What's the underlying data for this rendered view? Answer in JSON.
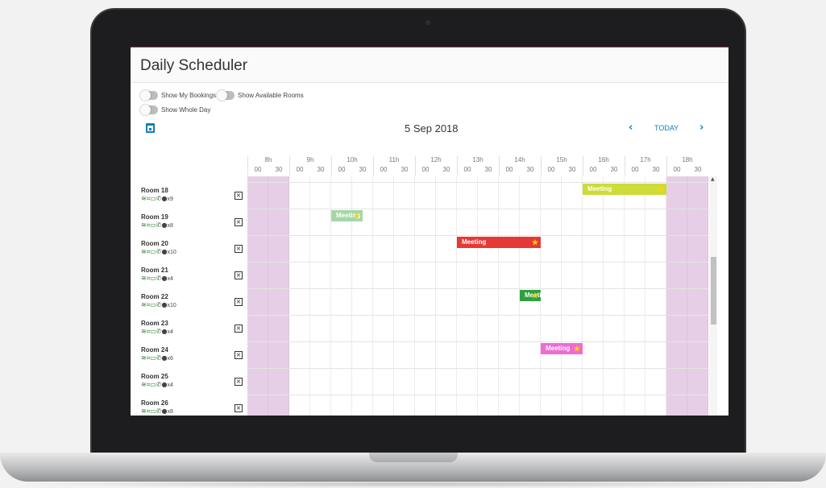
{
  "app": {
    "title": "Daily Scheduler"
  },
  "toggles": {
    "my_bookings": "Show My Bookings",
    "available_rooms": "Show Available Rooms",
    "whole_day": "Show Whole Day"
  },
  "date_nav": {
    "date": "5 Sep 2018",
    "prev": "‹",
    "today": "TODAY",
    "next": "›"
  },
  "timeline": {
    "hours": [
      "8h",
      "9h",
      "10h",
      "11h",
      "12h",
      "13h",
      "14h",
      "15h",
      "16h",
      "17h",
      "18h"
    ],
    "minutes": [
      "00",
      "30"
    ]
  },
  "rooms": [
    {
      "name": "Room 18",
      "capacity": "x9"
    },
    {
      "name": "Room 19",
      "capacity": "x8"
    },
    {
      "name": "Room 20",
      "capacity": "x10"
    },
    {
      "name": "Room 21",
      "capacity": "x4"
    },
    {
      "name": "Room 22",
      "capacity": "x10"
    },
    {
      "name": "Room 23",
      "capacity": "x4"
    },
    {
      "name": "Room 24",
      "capacity": "x6"
    },
    {
      "name": "Room 25",
      "capacity": "x4"
    },
    {
      "name": "Room 26",
      "capacity": "x8"
    }
  ],
  "events": [
    {
      "room_index": 0,
      "label": "Meeting",
      "start": "16:00",
      "end": "18:00",
      "color": "#cddc39"
    },
    {
      "room_index": 1,
      "label": "Meeting",
      "start": "10:00",
      "end": "10:45",
      "color": "#a5d6a7"
    },
    {
      "room_index": 2,
      "label": "Meeting",
      "start": "13:00",
      "end": "15:00",
      "color": "#e53935"
    },
    {
      "room_index": 4,
      "label": "Meeting",
      "start": "14:30",
      "end": "15:00",
      "color": "#2ea043"
    },
    {
      "room_index": 6,
      "label": "Meeting",
      "start": "15:00",
      "end": "16:00",
      "color": "#f06bd6"
    }
  ],
  "colors": {
    "accent": "#0d80b4",
    "off_hours": "#e6cfe6",
    "brand": "#8c3c6b"
  }
}
